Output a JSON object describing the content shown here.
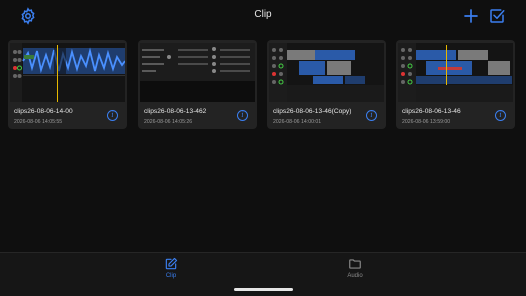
{
  "header": {
    "title": "Clip",
    "icons": {
      "settings": "gear-icon",
      "add": "plus-icon",
      "select": "checkbox-select-icon"
    },
    "accent_color": "#3b7ff0"
  },
  "clips": [
    {
      "name": "clips26-08-06-14-00",
      "date": "2026-08-06 14:05:55",
      "thumbnail": "waveform-editor"
    },
    {
      "name": "clips26-08-06-13-462",
      "date": "2026-08-06 14:05:26",
      "thumbnail": "mixer-panel"
    },
    {
      "name": "clips26-08-06-13-46(Copy)",
      "date": "2026-08-06 14:00:01",
      "thumbnail": "multitrack"
    },
    {
      "name": "clips26-08-06-13-46",
      "date": "2026-08-06 13:59:00",
      "thumbnail": "multitrack"
    }
  ],
  "tabbar": {
    "tabs": [
      {
        "label": "Clip",
        "icon": "edit-icon",
        "active": true
      },
      {
        "label": "Audio",
        "icon": "folder-icon",
        "active": false
      }
    ]
  }
}
